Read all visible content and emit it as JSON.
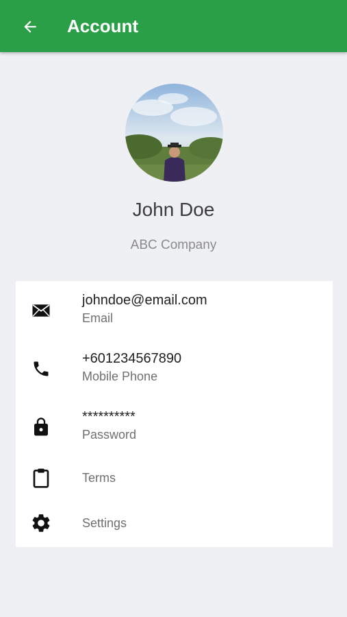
{
  "appbar": {
    "title": "Account",
    "back_icon": "arrow-left-icon",
    "color": "#2a9f47"
  },
  "profile": {
    "name": "John Doe",
    "company": "ABC Company"
  },
  "account_items": [
    {
      "icon": "mail-icon",
      "value": "johndoe@email.com",
      "label": "Email"
    },
    {
      "icon": "phone-icon",
      "value": "+601234567890",
      "label": "Mobile Phone"
    },
    {
      "icon": "lock-icon",
      "value": "**********",
      "label": "Password"
    },
    {
      "icon": "clipboard-icon",
      "label": "Terms"
    },
    {
      "icon": "gear-icon",
      "label": "Settings"
    }
  ]
}
